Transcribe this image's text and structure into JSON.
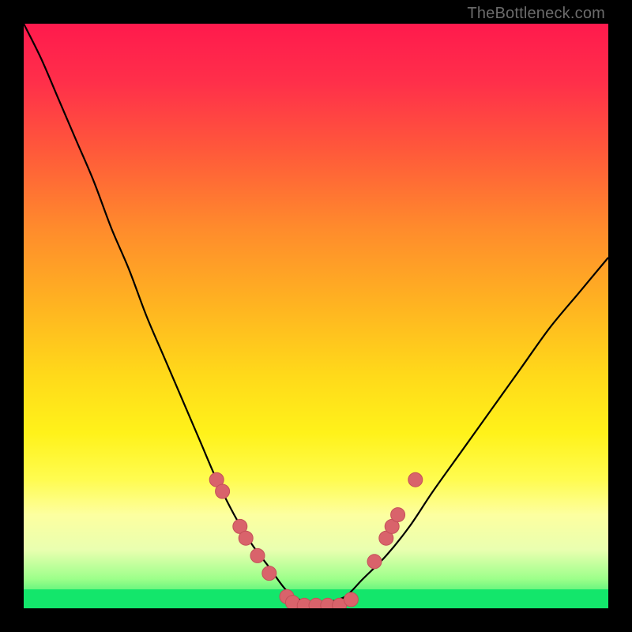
{
  "watermark": "TheBottleneck.com",
  "colors": {
    "frame": "#000000",
    "curve": "#000000",
    "marker_fill": "#d9636b",
    "marker_stroke": "#c45059",
    "green": "#13e66b"
  },
  "chart_data": {
    "type": "line",
    "title": "",
    "xlabel": "",
    "ylabel": "",
    "xlim": [
      0,
      100
    ],
    "ylim": [
      0,
      100
    ],
    "series": [
      {
        "name": "bottleneck-curve",
        "x": [
          0,
          3,
          6,
          9,
          12,
          15,
          18,
          21,
          24,
          27,
          30,
          33,
          36,
          39,
          42,
          45,
          48,
          50,
          52,
          55,
          58,
          62,
          66,
          70,
          75,
          80,
          85,
          90,
          95,
          100
        ],
        "y": [
          100,
          94,
          87,
          80,
          73,
          65,
          58,
          50,
          43,
          36,
          29,
          22,
          16,
          11,
          7,
          3,
          1,
          0,
          1,
          2,
          5,
          9,
          14,
          20,
          27,
          34,
          41,
          48,
          54,
          60
        ]
      }
    ],
    "markers": [
      {
        "x": 33,
        "y": 22
      },
      {
        "x": 34,
        "y": 20
      },
      {
        "x": 37,
        "y": 14
      },
      {
        "x": 38,
        "y": 12
      },
      {
        "x": 40,
        "y": 9
      },
      {
        "x": 42,
        "y": 6
      },
      {
        "x": 45,
        "y": 2
      },
      {
        "x": 46,
        "y": 1
      },
      {
        "x": 48,
        "y": 0.5
      },
      {
        "x": 50,
        "y": 0.5
      },
      {
        "x": 52,
        "y": 0.5
      },
      {
        "x": 54,
        "y": 0.5
      },
      {
        "x": 56,
        "y": 1.5
      },
      {
        "x": 60,
        "y": 8
      },
      {
        "x": 62,
        "y": 12
      },
      {
        "x": 63,
        "y": 14
      },
      {
        "x": 64,
        "y": 16
      },
      {
        "x": 67,
        "y": 22
      }
    ],
    "annotations": []
  }
}
